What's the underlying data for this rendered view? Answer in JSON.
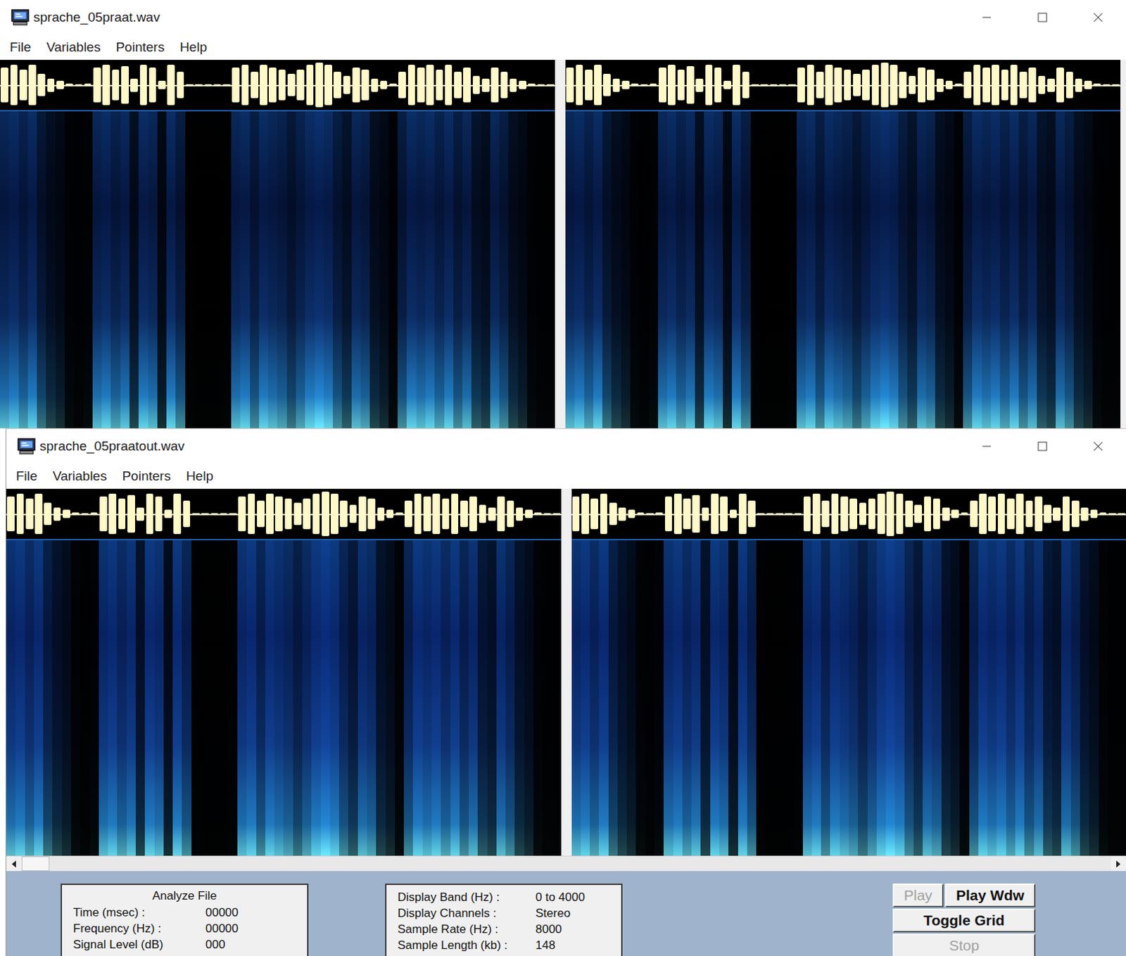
{
  "windows": [
    {
      "title": "sprache_05praat.wav",
      "menu": [
        "File",
        "Variables",
        "Pointers",
        "Help"
      ],
      "noise_level": 0.2,
      "channels": [
        {
          "envelope": [
            0.8,
            0.9,
            0.7,
            0.9,
            0.5,
            0.3,
            0.2,
            0.05,
            0.02,
            0.05,
            0.8,
            0.9,
            0.7,
            0.85,
            0.3,
            0.9,
            0.8,
            0.2,
            0.9,
            0.6,
            0.02,
            0.01,
            0.01,
            0.01,
            0.02,
            0.8,
            0.9,
            0.6,
            0.9,
            0.8,
            0.7,
            0.5,
            0.7,
            0.9,
            1.0,
            0.9,
            0.6,
            0.4,
            0.8,
            0.7,
            0.3,
            0.2,
            0.05,
            0.6,
            0.9,
            0.8,
            0.9,
            0.7,
            0.9,
            0.6,
            0.8,
            0.4,
            0.3,
            0.8,
            0.6,
            0.3,
            0.2,
            0.05,
            0.02,
            0.02
          ]
        },
        {
          "envelope": [
            0.8,
            0.9,
            0.7,
            0.9,
            0.5,
            0.3,
            0.2,
            0.05,
            0.02,
            0.05,
            0.8,
            0.9,
            0.7,
            0.85,
            0.3,
            0.9,
            0.8,
            0.2,
            0.9,
            0.6,
            0.02,
            0.01,
            0.01,
            0.01,
            0.02,
            0.8,
            0.9,
            0.6,
            0.9,
            0.8,
            0.7,
            0.5,
            0.7,
            0.9,
            1.0,
            0.9,
            0.6,
            0.4,
            0.8,
            0.7,
            0.3,
            0.2,
            0.05,
            0.6,
            0.9,
            0.8,
            0.9,
            0.7,
            0.9,
            0.6,
            0.8,
            0.4,
            0.3,
            0.8,
            0.6,
            0.3,
            0.2,
            0.05,
            0.02,
            0.02
          ]
        }
      ]
    },
    {
      "title": "sprache_05praatout.wav",
      "menu": [
        "File",
        "Variables",
        "Pointers",
        "Help"
      ],
      "noise_level": 0.7,
      "channels": [
        {
          "envelope": [
            0.8,
            0.9,
            0.7,
            0.9,
            0.5,
            0.3,
            0.2,
            0.05,
            0.02,
            0.05,
            0.8,
            0.9,
            0.7,
            0.85,
            0.3,
            0.9,
            0.8,
            0.2,
            0.9,
            0.6,
            0.02,
            0.01,
            0.01,
            0.01,
            0.02,
            0.8,
            0.9,
            0.6,
            0.9,
            0.8,
            0.7,
            0.5,
            0.7,
            0.9,
            1.0,
            0.9,
            0.6,
            0.4,
            0.8,
            0.7,
            0.3,
            0.2,
            0.05,
            0.6,
            0.9,
            0.8,
            0.9,
            0.7,
            0.9,
            0.6,
            0.8,
            0.4,
            0.3,
            0.8,
            0.6,
            0.3,
            0.2,
            0.05,
            0.02,
            0.02
          ]
        },
        {
          "envelope": [
            0.8,
            0.9,
            0.7,
            0.9,
            0.5,
            0.3,
            0.2,
            0.05,
            0.02,
            0.05,
            0.8,
            0.9,
            0.7,
            0.85,
            0.3,
            0.9,
            0.8,
            0.2,
            0.9,
            0.6,
            0.02,
            0.01,
            0.01,
            0.01,
            0.02,
            0.8,
            0.9,
            0.6,
            0.9,
            0.8,
            0.7,
            0.5,
            0.7,
            0.9,
            1.0,
            0.9,
            0.6,
            0.4,
            0.8,
            0.7,
            0.3,
            0.2,
            0.05,
            0.6,
            0.9,
            0.8,
            0.9,
            0.7,
            0.9,
            0.6,
            0.8,
            0.4,
            0.3,
            0.8,
            0.6,
            0.3,
            0.2,
            0.05,
            0.02,
            0.02
          ]
        }
      ],
      "scrollbar": {
        "level": 0.025
      },
      "status": {
        "analyze": {
          "title": "Analyze File",
          "rows": [
            {
              "label": "Time (msec) :",
              "value": "00000"
            },
            {
              "label": "Frequency (Hz) :",
              "value": "00000"
            },
            {
              "label": "Signal Level (dB)",
              "value": "000"
            }
          ]
        },
        "display": {
          "rows": [
            {
              "label": "Display Band (Hz) :",
              "value": "0 to 4000"
            },
            {
              "label": "Display Channels :",
              "value": "Stereo"
            },
            {
              "label": "Sample Rate (Hz) :",
              "value": "8000"
            },
            {
              "label": "Sample Length (kb) :",
              "value": "148"
            }
          ]
        },
        "buttons": [
          {
            "label": "Play",
            "disabled": true
          },
          {
            "label": "Play Wdw",
            "disabled": false
          },
          {
            "label": "Toggle Grid",
            "disabled": false
          },
          {
            "label": "Stop",
            "disabled": true
          }
        ]
      }
    }
  ]
}
